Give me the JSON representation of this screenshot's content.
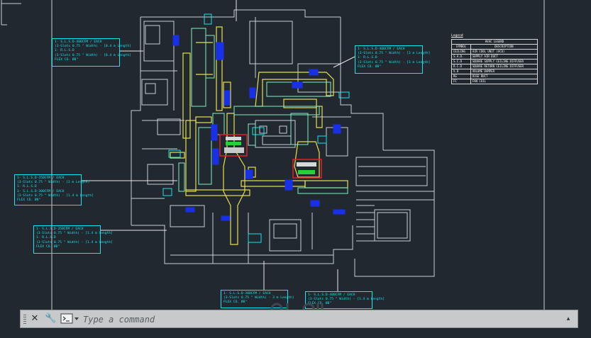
{
  "callouts": [
    {
      "id": "top-left",
      "lines": [
        "1- S.L.S.D-400CFM / EACH",
        "(3-Slots 0.75 \" Width) - [0.4 m Length]",
        "1- R.L.S.D",
        "(3-Slots 0.75 \" Width) - [0.4 m Length]",
        "FLEX CO. Ø8\""
      ]
    },
    {
      "id": "top-right",
      "lines": [
        "1- S.L.S.D-400CFM / EACH",
        "(3-Slots 0.75 \" Width) - [3 m Length]",
        "1- R.L.S.D",
        "(3-Slots 0.75 \" Width) - [3 m Length]",
        "FLEX CO. Ø8\""
      ]
    },
    {
      "id": "mid-left",
      "lines": [
        "1- S.L.S.D-350CFM / EACH",
        "(3-Slots 0.75 \" Width) - [3 m Length]",
        "1- R.L.S.D",
        "1- S.L.S.D-300CFM / EACH",
        "(3-Slots 0.75 \" Width) - [1.4 m Length]",
        "FLEX CO. Ø8\""
      ]
    },
    {
      "id": "lower-left",
      "lines": [
        "1- S.L.S.D-350CFM / EACH",
        "(3-Slots 0.75 \" Width) - [1.4 m Length]",
        "1- R.L.S.D",
        "(3-Slots 0.75 \" Width) - [1.4 m Length]",
        "FLEX CO. Ø8\""
      ]
    },
    {
      "id": "bottom-center",
      "lines": [
        "1- S.L.S.D-300CFM / EACH",
        "(3-Slots 0.75 \" Width) - 3 m Length]",
        "FLEX CO. Ø8\""
      ]
    },
    {
      "id": "bottom-right",
      "lines": [
        "1- S.L.S.D-400CFM / EACH",
        "(3-Slots 0.75 \" Width) - [1.4 m Length]",
        "FLEX CO. Ø8\""
      ]
    }
  ],
  "legend": {
    "title": "Legend",
    "table_title": "HVAC LEGEND",
    "col_symbol": "SYMBOL",
    "col_description": "DESCRIPTION",
    "rows": [
      {
        "symbol": "CEILING",
        "description": "AIR COOL UNIT (ACU)"
      },
      {
        "symbol": "S.A.D.",
        "description": "SUPPLY AIR DUCT"
      },
      {
        "symbol": "S.C.D",
        "description": "SQUARE SUPPLY CEILING DIFFUSER"
      },
      {
        "symbol": "R.C.D",
        "description": "SQUARE RETURN CEILING DIFFUSER"
      },
      {
        "symbol": "V.D",
        "description": "VOLUME DAMPER"
      },
      {
        "symbol": "RG",
        "description": "RISE DUCT"
      },
      {
        "symbol": "FC",
        "description": "FAN COIL"
      }
    ]
  },
  "command_line": {
    "close_label": "✕",
    "customize_label": "🔧",
    "prompt_label": ">_",
    "prompt_dropdown": "▾",
    "placeholder": "Type a command",
    "history_arrow": "▴"
  },
  "colors": {
    "background": "#212830",
    "walls": "#c9ced4",
    "supply_duct": "#e8e04a",
    "return_duct": "#7ef0c0",
    "callout": "#14e6ee",
    "equipment_red": "#e0202a",
    "equipment_green": "#25d040",
    "blue_blocks": "#1a2fe8"
  }
}
